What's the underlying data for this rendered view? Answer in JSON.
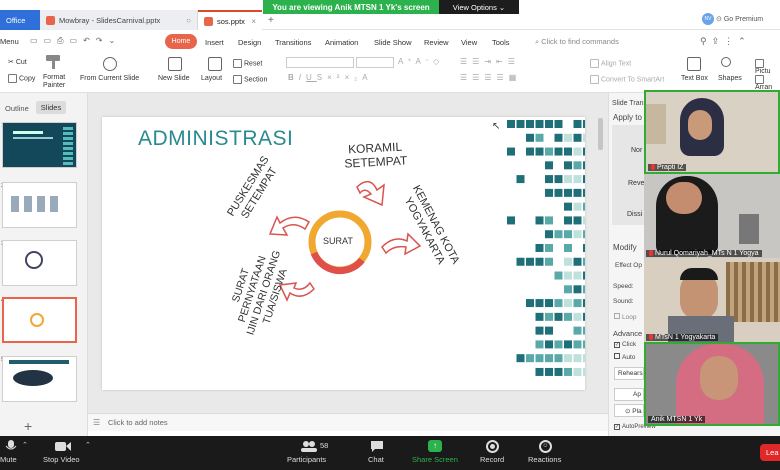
{
  "titlebar": {
    "office_tab": "Office",
    "doc_tab_1": "Mowbray - SlidesCarnival.pptx",
    "doc_tab_2": "sos.pptx",
    "viewing_banner": "You are viewing Anik MTSN 1 Yk's screen",
    "view_options": "View Options",
    "avatar": "NV",
    "go_premium": "Go Premium"
  },
  "ribbon": {
    "menu": "Menu",
    "tabs": [
      "Home",
      "Insert",
      "Design",
      "Transitions",
      "Animation",
      "Slide Show",
      "Review",
      "View",
      "Tools"
    ],
    "search_placeholder": "Click to find commands",
    "tools": {
      "cut": "Cut",
      "copy": "Copy",
      "format_painter_1": "Format",
      "format_painter_2": "Painter",
      "from_current": "From Current Slide",
      "new_slide": "New Slide",
      "layout": "Layout",
      "reset": "Reset",
      "section": "Section",
      "align_text": "Align Text",
      "convert_smartart": "Convert To SmartArt",
      "text_box": "Text Box",
      "shapes": "Shapes",
      "picture": "Pictu",
      "arrange": "Arran"
    }
  },
  "left_panel": {
    "outline_tab": "Outline",
    "slides_tab": "Slides",
    "slide_numbers": [
      "1",
      "2",
      "3",
      "4",
      "5"
    ]
  },
  "slide": {
    "title": "ADMINISTRASI",
    "center": "SURAT",
    "koramil_1": "KORAMIL",
    "koramil_2": "SETEMPAT",
    "puskesmas_1": "PUSKESMAS",
    "puskesmas_2": "SETEMPAT",
    "kemenag_1": "KEMENAG KOTA",
    "kemenag_2": "YOGYAKARTA",
    "surat_pern_1": "SURAT",
    "surat_pern_2": "PERNYATAAN",
    "surat_pern_3": "IJIN DARI ORANG",
    "surat_pern_4": "TUA/SISWA",
    "colors": {
      "title": "#2a8a8f",
      "ring_orange": "#f0a830",
      "ring_red": "#e0504a",
      "arrow": "#d9534f",
      "teal_dark": "#1f6f78",
      "teal_light": "#bfe1dc"
    }
  },
  "notes": "Click to add notes",
  "right_pane": {
    "title": "Slide Trans",
    "apply_to": "Apply to",
    "labels": [
      "Nor",
      "Reve",
      "Dissi"
    ],
    "modify": "Modify",
    "effect": "Effect Op",
    "speed": "Speed:",
    "sound": "Sound:",
    "loop": "Loop",
    "advance": "Advance",
    "click": "Click",
    "auto": "Auto",
    "rehearse": "Rehears",
    "apply": "Ap",
    "play": "Pla",
    "autopreview": "AutoPreview"
  },
  "participants_videos": [
    "Prapti IZ",
    "Nurul Qomariyah_MTs N 1 Yogya",
    "MTsN 1 Yogyakarta",
    "Anik MTSN 1 Yk"
  ],
  "zoom_toolbar": {
    "mute": "Mute",
    "stop_video": "Stop Video",
    "participants": "Participants",
    "participants_count": "58",
    "chat": "Chat",
    "share_screen": "Share Screen",
    "record": "Record",
    "reactions": "Reactions",
    "leave": "Lea"
  }
}
